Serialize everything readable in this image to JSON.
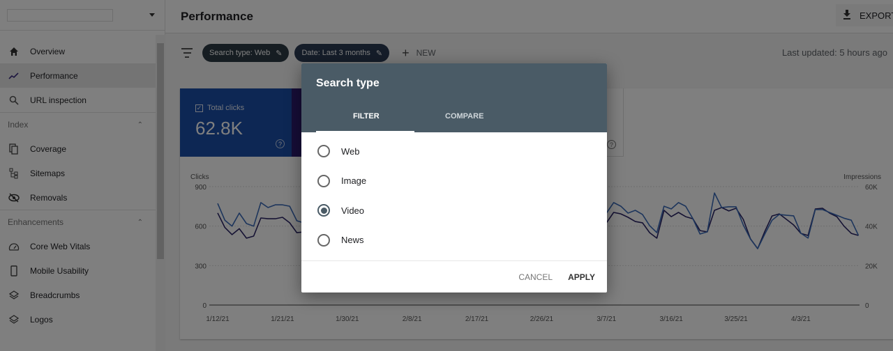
{
  "sidebar": {
    "property_selector": "",
    "items": [
      {
        "label": "Overview",
        "icon": "home-icon"
      },
      {
        "label": "Performance",
        "icon": "trending-icon",
        "active": true
      },
      {
        "label": "URL inspection",
        "icon": "search-icon"
      }
    ],
    "sections": [
      {
        "title": "Index",
        "items": [
          {
            "label": "Coverage",
            "icon": "coverage-icon"
          },
          {
            "label": "Sitemaps",
            "icon": "sitemap-icon"
          },
          {
            "label": "Removals",
            "icon": "removal-icon"
          }
        ]
      },
      {
        "title": "Enhancements",
        "items": [
          {
            "label": "Core Web Vitals",
            "icon": "gauge-icon"
          },
          {
            "label": "Mobile Usability",
            "icon": "mobile-icon"
          },
          {
            "label": "Breadcrumbs",
            "icon": "layers-icon"
          },
          {
            "label": "Logos",
            "icon": "layers-icon"
          }
        ]
      }
    ]
  },
  "header": {
    "title": "Performance",
    "export_label": "EXPORT"
  },
  "filters": {
    "chips": [
      "Search type: Web",
      "Date: Last 3 months"
    ],
    "new_label": "NEW",
    "last_updated": "Last updated: 5 hours ago"
  },
  "metrics": {
    "total_clicks_label": "Total clicks",
    "total_clicks_value": "62.8K",
    "help": "?"
  },
  "dialog": {
    "title": "Search type",
    "tabs": [
      "FILTER",
      "COMPARE"
    ],
    "active_tab": "FILTER",
    "options": [
      "Web",
      "Image",
      "Video",
      "News"
    ],
    "selected": "Video",
    "cancel_label": "CANCEL",
    "apply_label": "APPLY"
  },
  "colors": {
    "clicks": "#2a2466",
    "impressions": "#3a6ab8",
    "dialog_header": "#4a5b66",
    "clicks_card": "#1a4ea8"
  },
  "chart_data": {
    "type": "line",
    "title": "",
    "x_ticks": [
      "1/12/21",
      "1/21/21",
      "1/30/21",
      "2/8/21",
      "2/17/21",
      "2/26/21",
      "3/7/21",
      "3/16/21",
      "3/25/21",
      "4/3/21"
    ],
    "y_left": {
      "label": "Clicks",
      "ticks": [
        0,
        300,
        600,
        900
      ],
      "range": [
        0,
        900
      ]
    },
    "y_right": {
      "label": "Impressions",
      "ticks": [
        "0",
        "20K",
        "40K",
        "60K"
      ],
      "range": [
        0,
        60000
      ]
    },
    "x_range_days": [
      0,
      91
    ],
    "grid": true,
    "series": [
      {
        "name": "Clicks",
        "axis": "left",
        "points": [
          [
            0,
            700
          ],
          [
            1,
            590
          ],
          [
            2,
            535
          ],
          [
            3,
            580
          ],
          [
            4,
            508
          ],
          [
            5,
            524
          ],
          [
            6,
            662
          ],
          [
            7,
            656
          ],
          [
            8,
            656
          ],
          [
            9,
            667
          ],
          [
            10,
            625
          ],
          [
            11,
            550
          ],
          [
            12,
            556
          ],
          [
            54,
            625
          ],
          [
            55,
            704
          ],
          [
            56,
            693
          ],
          [
            57,
            667
          ],
          [
            58,
            635
          ],
          [
            59,
            625
          ],
          [
            60,
            550
          ],
          [
            61,
            508
          ],
          [
            62,
            720
          ],
          [
            63,
            672
          ],
          [
            64,
            704
          ],
          [
            65,
            672
          ],
          [
            66,
            656
          ],
          [
            67,
            566
          ],
          [
            68,
            556
          ],
          [
            69,
            720
          ],
          [
            70,
            741
          ],
          [
            71,
            715
          ],
          [
            72,
            736
          ],
          [
            73,
            651
          ],
          [
            74,
            503
          ],
          [
            75,
            429
          ],
          [
            76,
            560
          ],
          [
            77,
            677
          ],
          [
            78,
            693
          ],
          [
            79,
            651
          ],
          [
            80,
            609
          ],
          [
            81,
            545
          ],
          [
            82,
            529
          ],
          [
            83,
            730
          ],
          [
            84,
            736
          ],
          [
            85,
            699
          ],
          [
            86,
            672
          ],
          [
            87,
            600
          ],
          [
            88,
            545
          ],
          [
            89,
            529
          ]
        ]
      },
      {
        "name": "Impressions",
        "axis": "right",
        "points": [
          [
            0,
            51500
          ],
          [
            1,
            43000
          ],
          [
            2,
            40000
          ],
          [
            3,
            46600
          ],
          [
            4,
            41300
          ],
          [
            5,
            40000
          ],
          [
            6,
            51900
          ],
          [
            7,
            49400
          ],
          [
            8,
            50800
          ],
          [
            9,
            50800
          ],
          [
            10,
            50100
          ],
          [
            11,
            42700
          ],
          [
            12,
            41600
          ],
          [
            54,
            46600
          ],
          [
            55,
            51900
          ],
          [
            56,
            50100
          ],
          [
            57,
            46600
          ],
          [
            58,
            48000
          ],
          [
            59,
            45900
          ],
          [
            60,
            40200
          ],
          [
            61,
            36700
          ],
          [
            62,
            50100
          ],
          [
            63,
            48700
          ],
          [
            64,
            51900
          ],
          [
            65,
            50100
          ],
          [
            66,
            43800
          ],
          [
            67,
            36000
          ],
          [
            68,
            37100
          ],
          [
            69,
            56800
          ],
          [
            70,
            49400
          ],
          [
            71,
            49800
          ],
          [
            72,
            49800
          ],
          [
            73,
            40600
          ],
          [
            74,
            33500
          ],
          [
            75,
            28600
          ],
          [
            76,
            36000
          ],
          [
            77,
            43000
          ],
          [
            78,
            45900
          ],
          [
            79,
            45500
          ],
          [
            80,
            45200
          ],
          [
            81,
            36400
          ],
          [
            82,
            33900
          ],
          [
            83,
            48400
          ],
          [
            84,
            48400
          ],
          [
            85,
            46900
          ],
          [
            86,
            45500
          ],
          [
            87,
            44000
          ],
          [
            88,
            43000
          ],
          [
            89,
            35300
          ]
        ]
      }
    ]
  }
}
